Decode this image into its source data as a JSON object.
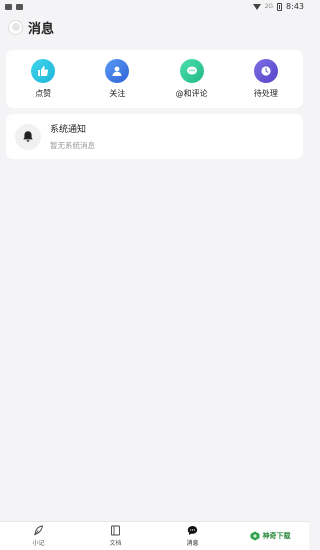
{
  "status_bar": {
    "time": "8:43",
    "sim_label": "2G"
  },
  "header": {
    "title": "消息"
  },
  "actions": [
    {
      "label": "点赞",
      "icon": "thumbs-up-icon",
      "color": "#2ec6e2"
    },
    {
      "label": "关注",
      "icon": "person-icon",
      "color": "#3b7ce8"
    },
    {
      "label": "@和评论",
      "icon": "chat-bubble-icon",
      "color": "#2fcf9a"
    },
    {
      "label": "待处理",
      "icon": "clock-icon",
      "color": "#6b5bd8"
    }
  ],
  "notice": {
    "title": "系统通知",
    "subtitle": "暂无系统消息",
    "icon": "bell-icon"
  },
  "bottom_nav": {
    "items": [
      {
        "label": "小记",
        "icon": "feather-icon"
      },
      {
        "label": "文档",
        "icon": "document-icon"
      },
      {
        "label": "消息",
        "icon": "chat-icon",
        "active": true
      }
    ],
    "brand": "神奇下载"
  }
}
